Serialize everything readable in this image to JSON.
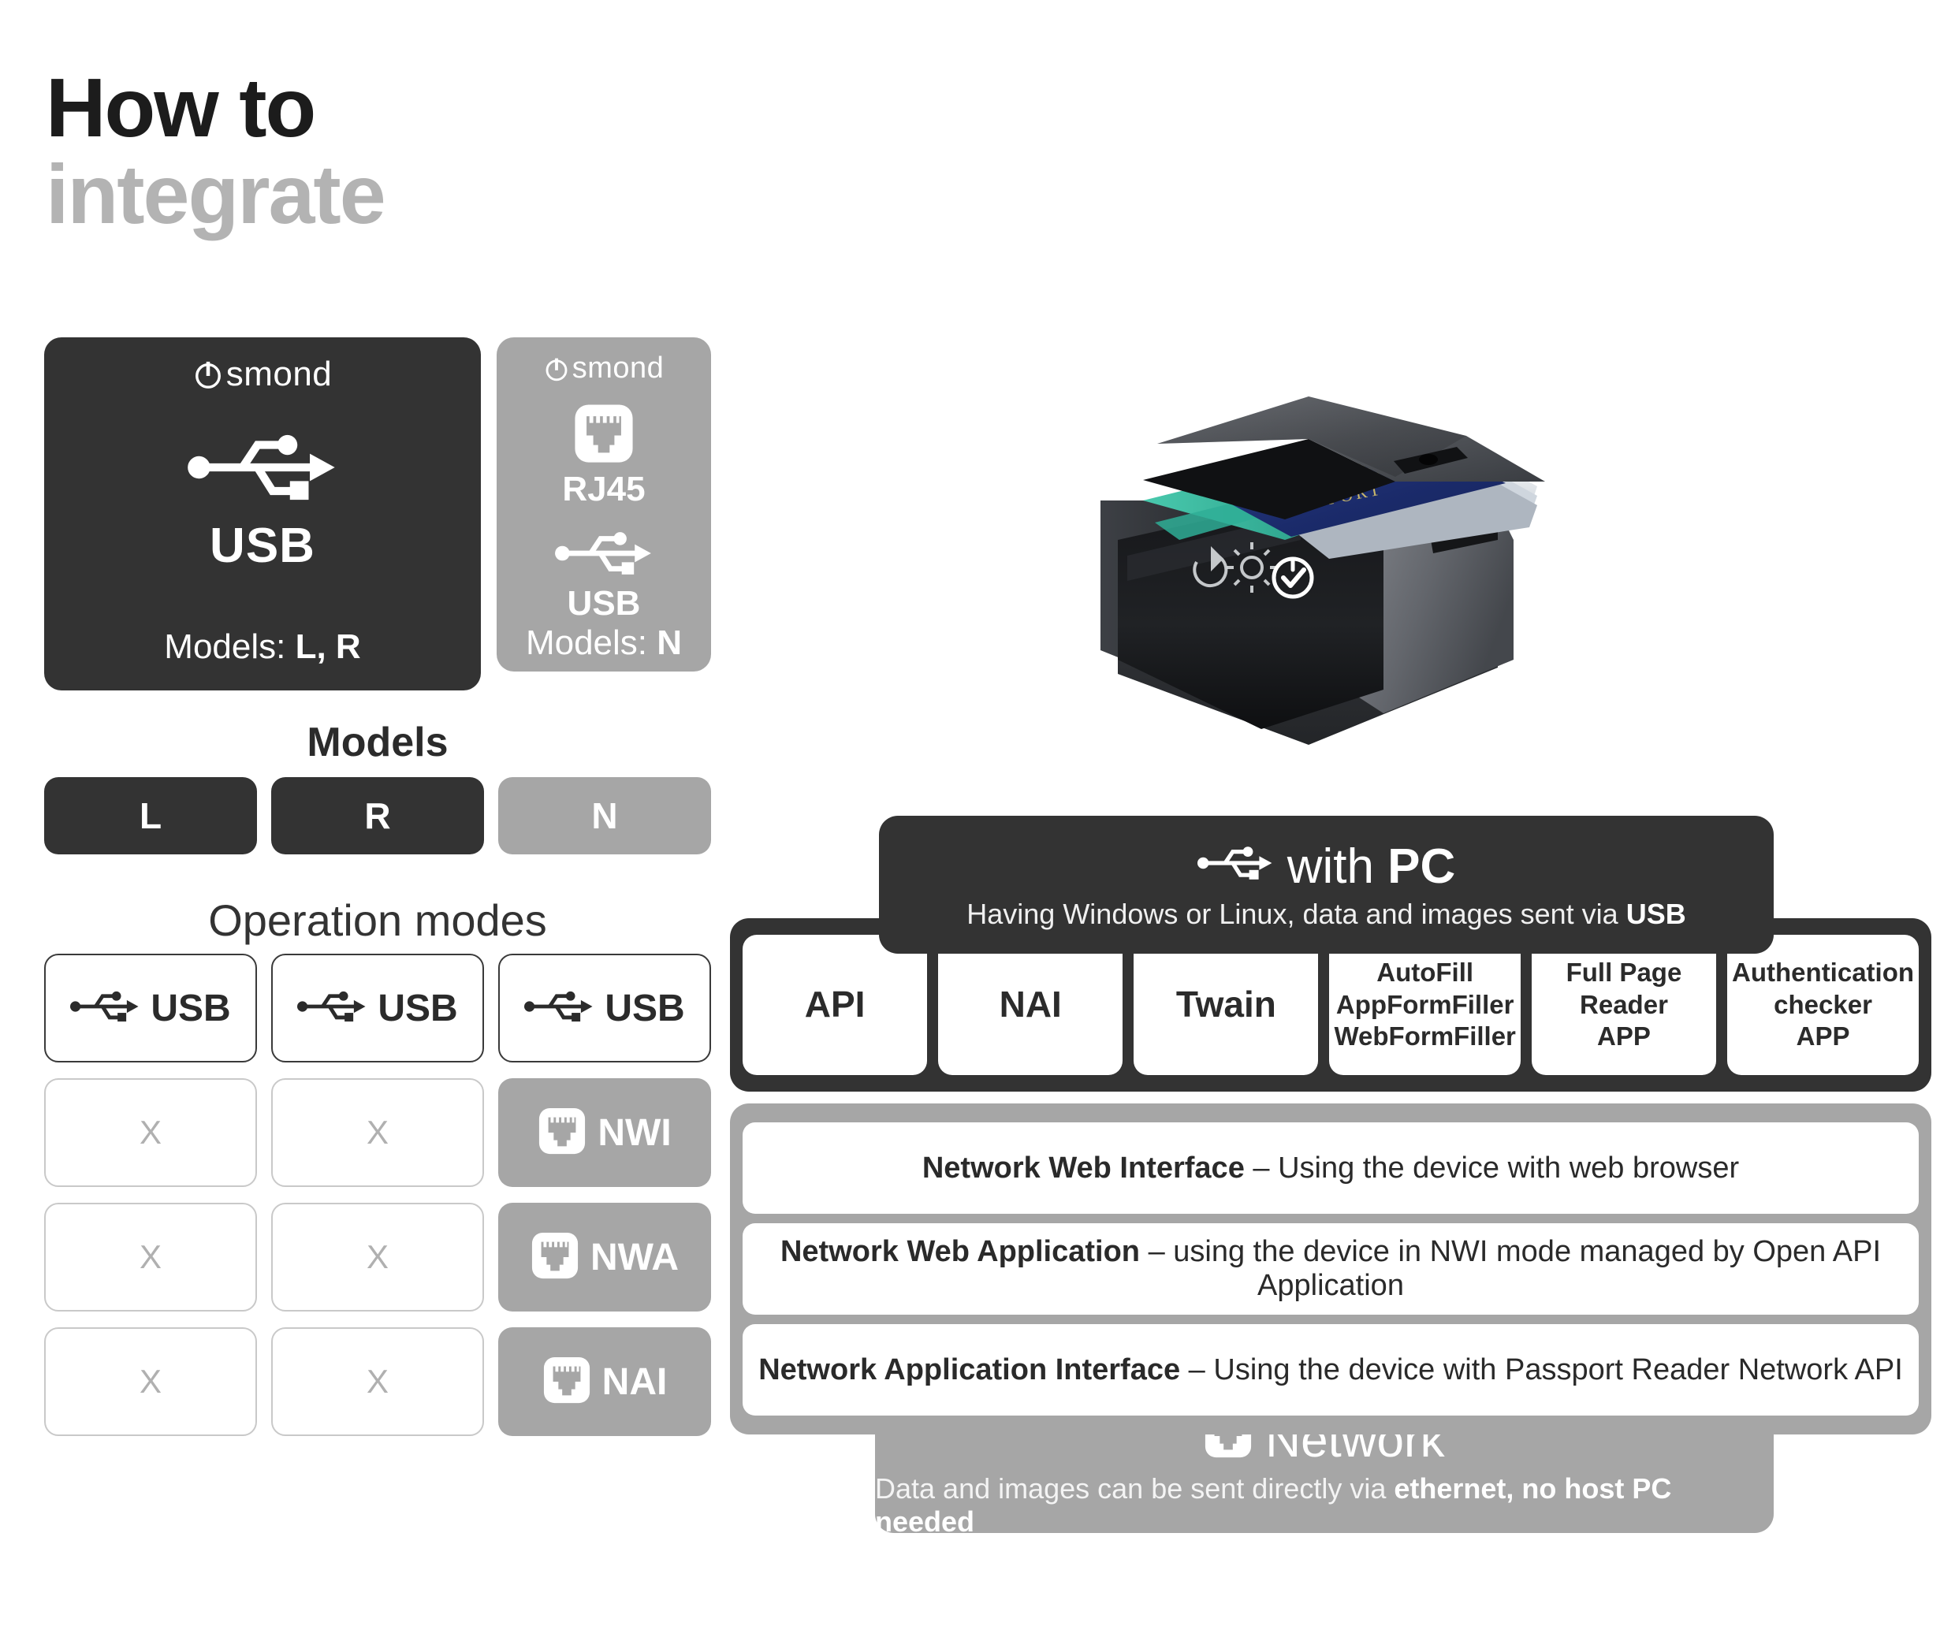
{
  "title": {
    "line1": "How to",
    "line2": "integrate"
  },
  "brand": "smond",
  "connector_cards": [
    {
      "id": "usb-card",
      "brand": "smond",
      "ports": [
        {
          "icon": "usb-icon",
          "label": "USB"
        }
      ],
      "models_prefix": "Models: ",
      "models_value": "L, R",
      "theme": "dark"
    },
    {
      "id": "network-card",
      "brand": "smond",
      "ports": [
        {
          "icon": "rj45-icon",
          "label": "RJ45"
        },
        {
          "icon": "usb-icon",
          "label": "USB"
        }
      ],
      "models_prefix": "Models: ",
      "models_value": "N",
      "theme": "gray"
    }
  ],
  "models_section": {
    "heading": "Models",
    "chips": [
      {
        "label": "L",
        "theme": "dark"
      },
      {
        "label": "R",
        "theme": "dark"
      },
      {
        "label": "N",
        "theme": "gray"
      }
    ]
  },
  "operation_modes": {
    "heading": "Operation modes",
    "rows": [
      [
        {
          "kind": "usb",
          "icon": "usb-icon",
          "label": "USB"
        },
        {
          "kind": "usb",
          "icon": "usb-icon",
          "label": "USB"
        },
        {
          "kind": "usb",
          "icon": "usb-icon",
          "label": "USB"
        }
      ],
      [
        {
          "kind": "empty",
          "label": "X"
        },
        {
          "kind": "empty",
          "label": "X"
        },
        {
          "kind": "net",
          "icon": "rj45-icon",
          "label": "NWI"
        }
      ],
      [
        {
          "kind": "empty",
          "label": "X"
        },
        {
          "kind": "empty",
          "label": "X"
        },
        {
          "kind": "net",
          "icon": "rj45-icon",
          "label": "NWA"
        }
      ],
      [
        {
          "kind": "empty",
          "label": "X"
        },
        {
          "kind": "empty",
          "label": "X"
        },
        {
          "kind": "net",
          "icon": "rj45-icon",
          "label": "NAI"
        }
      ]
    ]
  },
  "device_photo": {
    "name": "passport-reader-device",
    "document_label": "PASSPORT"
  },
  "pc_panel": {
    "header": {
      "icon": "usb-icon",
      "title_plain": "with ",
      "title_strong": "PC",
      "subtitle_plain": "Having Windows or Linux, data and images sent via ",
      "subtitle_strong": "USB"
    },
    "buttons": [
      {
        "lines": [
          "API"
        ],
        "size": "large"
      },
      {
        "lines": [
          "NAI"
        ],
        "size": "large"
      },
      {
        "lines": [
          "Twain"
        ],
        "size": "large"
      },
      {
        "lines": [
          "AutoFill",
          "AppFormFiller",
          "WebFormFiller"
        ],
        "size": "small"
      },
      {
        "lines": [
          "Full Page",
          "Reader",
          "APP"
        ],
        "size": "small"
      },
      {
        "lines": [
          "Authentication",
          "checker",
          "APP"
        ],
        "size": "small"
      }
    ]
  },
  "network_panel": {
    "rows": [
      {
        "strong": "Network Web Interface",
        "rest": " – Using the device with web browser"
      },
      {
        "strong": "Network Web Application",
        "rest": " – using the device in NWI mode managed by Open API Application"
      },
      {
        "strong": "Network Application Interface",
        "rest": " – Using the device with Passport Reader Network API"
      }
    ],
    "footer": {
      "icon": "rj45-icon",
      "title": "Network",
      "subtitle_plain": "Data and images can be sent directly via ",
      "subtitle_strong": "ethernet, no host PC needed"
    }
  },
  "colors": {
    "dark": "#333333",
    "gray": "#a6a6a6",
    "title_dark": "#1c1c1c",
    "title_gray": "#b3b3b3",
    "white": "#ffffff"
  }
}
